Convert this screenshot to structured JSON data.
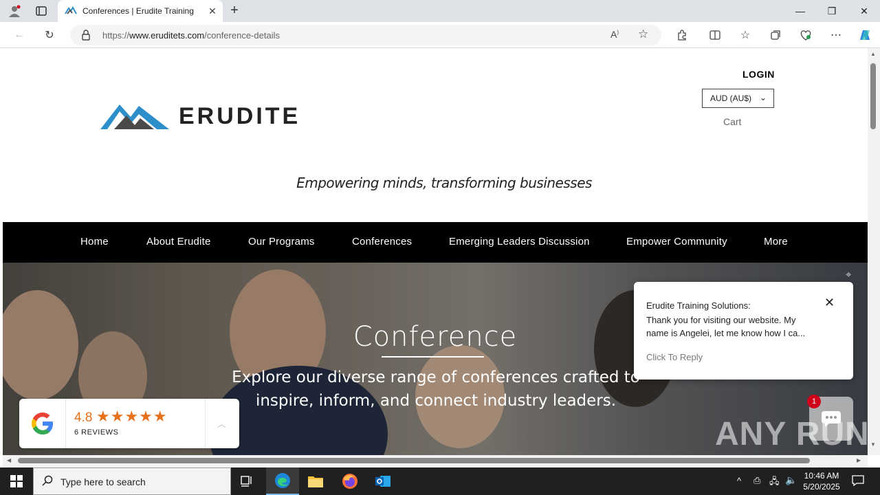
{
  "browser": {
    "tab_title": "Conferences | Erudite Training",
    "url_prefix": "https://",
    "url_host": "www.eruditets.com",
    "url_path": "/conference-details"
  },
  "header": {
    "logo_text": "ERUDITE",
    "login": "LOGIN",
    "currency": "AUD (AU$)",
    "cart": "Cart",
    "tagline": "Empowering minds, transforming businesses"
  },
  "menu": {
    "items": [
      "Home",
      "About Erudite",
      "Our Programs",
      "Conferences",
      "Emerging Leaders Discussion",
      "Empower Community",
      "More"
    ]
  },
  "hero": {
    "title": "Conference",
    "subtitle": "Explore our diverse range of conferences crafted to inspire, inform, and connect industry leaders."
  },
  "chat": {
    "from": "Erudite Training Solutions:",
    "message": "Thank you for visiting our website. My name is Angelei, let me know how I ca...",
    "reply": "Click To Reply",
    "badge": "1"
  },
  "reviews": {
    "rating": "4.8",
    "stars": "★★★★★",
    "count": "6 REVIEWS"
  },
  "watermark": "ANY RUN",
  "taskbar": {
    "search_placeholder": "Type here to search",
    "time": "10:46 AM",
    "date": "5/20/2025"
  },
  "colors": {
    "accent_blue": "#2c8fc9",
    "menu_bg": "#000000",
    "star": "#e7711b"
  }
}
